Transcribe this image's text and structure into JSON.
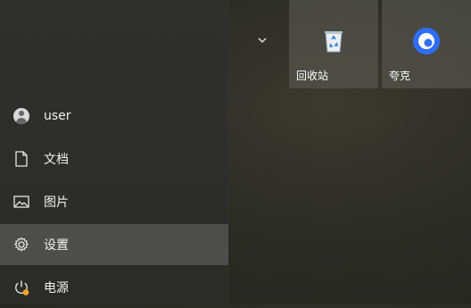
{
  "start_menu": {
    "menu": [
      {
        "label": "user",
        "icon": "user-avatar-icon"
      },
      {
        "label": "文档",
        "icon": "document-icon"
      },
      {
        "label": "图片",
        "icon": "picture-icon"
      },
      {
        "label": "设置",
        "icon": "gear-icon"
      },
      {
        "label": "电源",
        "icon": "power-icon"
      }
    ],
    "tiles": [
      {
        "label": "回收站",
        "icon": "recycle-bin-icon"
      },
      {
        "label": "夸克",
        "icon": "quark-browser-icon"
      }
    ]
  },
  "colors": {
    "panel": "#2f2f2c",
    "hover": "#5a5a56",
    "tile": "#5f5f58",
    "power_badge": "#f5a623",
    "quark_blue": "#2f6df6"
  }
}
